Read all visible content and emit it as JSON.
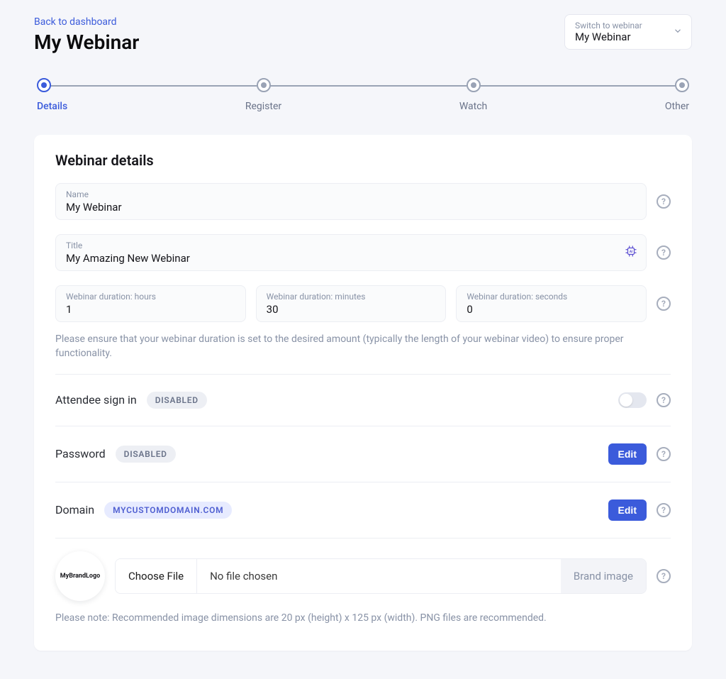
{
  "header": {
    "back_link": "Back to dashboard",
    "title": "My Webinar",
    "switch": {
      "label": "Switch to webinar",
      "value": "My Webinar"
    }
  },
  "stepper": {
    "steps": [
      {
        "label": "Details",
        "active": true
      },
      {
        "label": "Register",
        "active": false
      },
      {
        "label": "Watch",
        "active": false
      },
      {
        "label": "Other",
        "active": false
      }
    ]
  },
  "card": {
    "title": "Webinar details",
    "name": {
      "label": "Name",
      "value": "My Webinar"
    },
    "title_field": {
      "label": "Title",
      "value": "My Amazing New Webinar"
    },
    "duration": {
      "hours": {
        "label": "Webinar duration: hours",
        "value": "1"
      },
      "minutes": {
        "label": "Webinar duration: minutes",
        "value": "30"
      },
      "seconds": {
        "label": "Webinar duration: seconds",
        "value": "0"
      }
    },
    "duration_hint": "Please ensure that your webinar duration is set to the desired amount (typically the length of your webinar video) to ensure proper functionality.",
    "signin": {
      "label": "Attendee sign in",
      "badge": "DISABLED"
    },
    "password": {
      "label": "Password",
      "badge": "DISABLED",
      "button": "Edit"
    },
    "domain": {
      "label": "Domain",
      "badge": "MYCUSTOMDOMAIN.COM",
      "button": "Edit"
    },
    "brand": {
      "logo_text": "MyBrandLogo",
      "choose": "Choose File",
      "no_file": "No file chosen",
      "label": "Brand image",
      "hint": "Please note: Recommended image dimensions are 20 px (height) x 125 px (width). PNG files are recommended."
    }
  }
}
